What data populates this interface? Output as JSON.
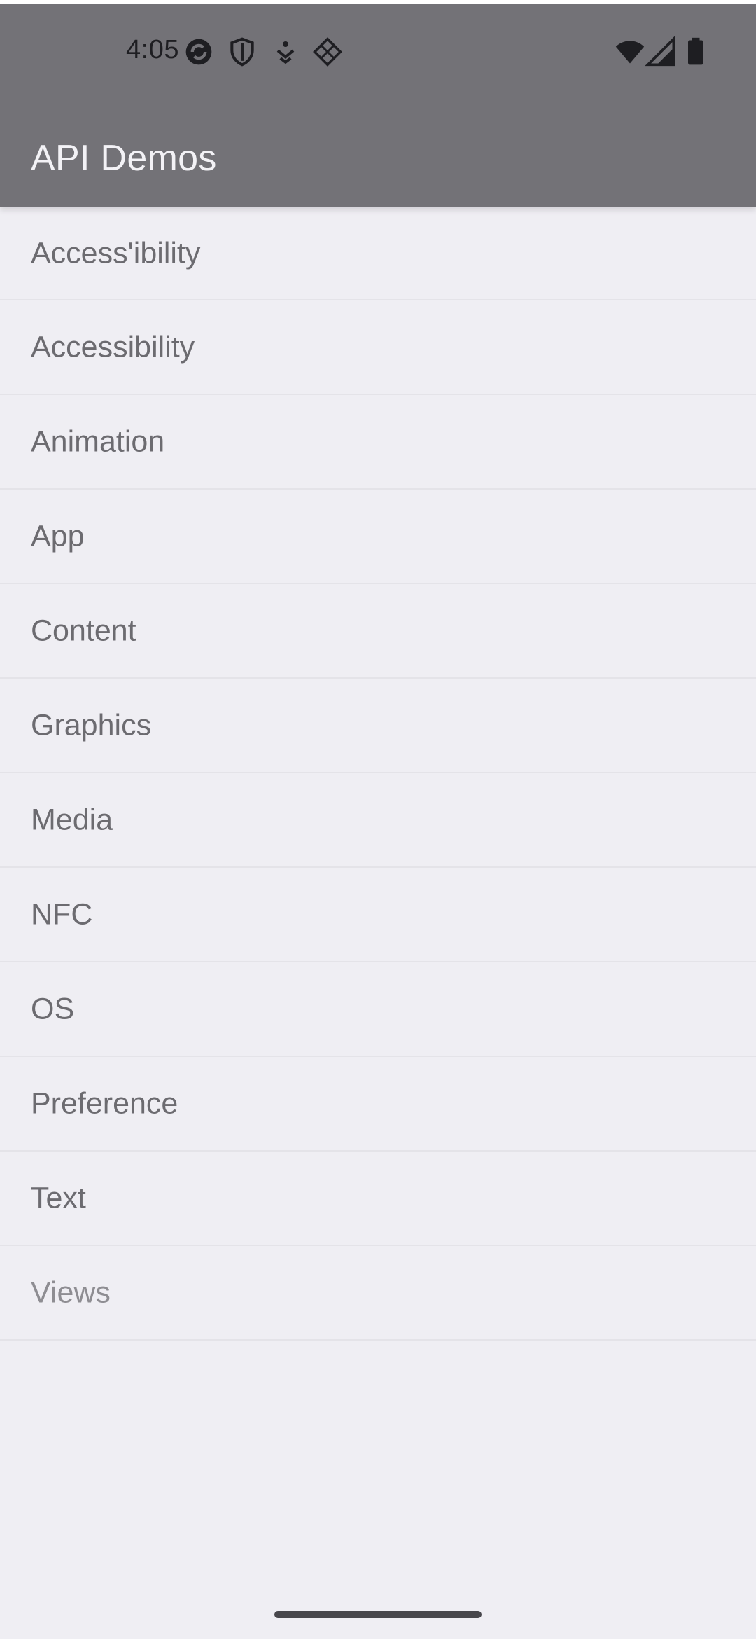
{
  "status_bar": {
    "time": "4:05",
    "left_icons": [
      "sync-icon",
      "shield-icon",
      "accessibility-icon",
      "grid-diamond-icon"
    ],
    "right_icons": [
      "wifi-icon",
      "cell-signal-icon",
      "battery-icon"
    ]
  },
  "app_bar": {
    "title": "API Demos",
    "background_color": "#737277"
  },
  "list": {
    "items": [
      {
        "label": "Access'ibility"
      },
      {
        "label": "Accessibility"
      },
      {
        "label": "Animation"
      },
      {
        "label": "App"
      },
      {
        "label": "Content"
      },
      {
        "label": "Graphics"
      },
      {
        "label": "Media"
      },
      {
        "label": "NFC"
      },
      {
        "label": "OS"
      },
      {
        "label": "Preference"
      },
      {
        "label": "Text"
      },
      {
        "label": "Views"
      }
    ]
  },
  "navigation": {
    "home_indicator": "gesture-bar"
  }
}
